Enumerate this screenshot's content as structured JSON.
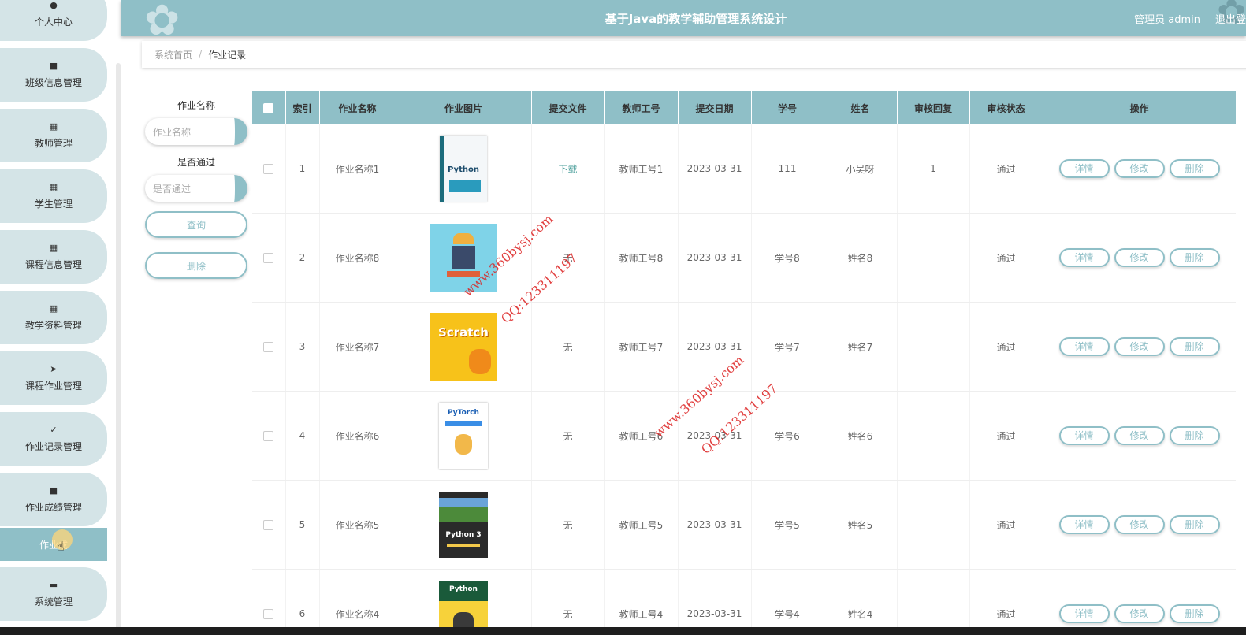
{
  "header": {
    "title": "基于Java的教学辅助管理系统设计",
    "user": "管理员 admin",
    "logout": "退出登"
  },
  "breadcrumb": {
    "home": "系统首页",
    "separator": "/",
    "current": "作业记录"
  },
  "sidebar": {
    "items": [
      {
        "label": "个人中心",
        "icon": "user-icon"
      },
      {
        "label": "班级信息管理",
        "icon": "board-icon"
      },
      {
        "label": "教师管理",
        "icon": "grid-icon"
      },
      {
        "label": "学生管理",
        "icon": "grid-icon"
      },
      {
        "label": "课程信息管理",
        "icon": "grid-icon"
      },
      {
        "label": "教学资料管理",
        "icon": "grid-icon"
      },
      {
        "label": "课程作业管理",
        "icon": "send-icon"
      },
      {
        "label": "作业记录管理",
        "icon": "clipboard-icon"
      },
      {
        "label": "作业成绩管理",
        "icon": "chat-icon"
      },
      {
        "label": "系统管理",
        "icon": "wallet-icon"
      }
    ],
    "active_sub": "作业成"
  },
  "search": {
    "name_label": "作业名称",
    "name_placeholder": "作业名称",
    "pass_label": "是否通过",
    "pass_placeholder": "是否通过",
    "query_button": "查询",
    "delete_button": "删除"
  },
  "table": {
    "headers": [
      "索引",
      "作业名称",
      "作业图片",
      "提交文件",
      "教师工号",
      "提交日期",
      "学号",
      "姓名",
      "审核回复",
      "审核状态",
      "操作"
    ],
    "rows": [
      {
        "index": "1",
        "name": "作业名称1",
        "image": "Python",
        "file": "下载",
        "teacher": "教师工号1",
        "date": "2023-03-31",
        "sid": "111",
        "sname": "小吴呀",
        "reply": "1",
        "status": "通过"
      },
      {
        "index": "2",
        "name": "作业名称8",
        "image": "",
        "file": "无",
        "teacher": "教师工号8",
        "date": "2023-03-31",
        "sid": "学号8",
        "sname": "姓名8",
        "reply": "",
        "status": "通过"
      },
      {
        "index": "3",
        "name": "作业名称7",
        "image": "Scratch",
        "file": "无",
        "teacher": "教师工号7",
        "date": "2023-03-31",
        "sid": "学号7",
        "sname": "姓名7",
        "reply": "",
        "status": "通过"
      },
      {
        "index": "4",
        "name": "作业名称6",
        "image": "PyTorch",
        "file": "无",
        "teacher": "教师工号6",
        "date": "2023-03-31",
        "sid": "学号6",
        "sname": "姓名6",
        "reply": "",
        "status": "通过"
      },
      {
        "index": "5",
        "name": "作业名称5",
        "image": "Python 3",
        "file": "无",
        "teacher": "教师工号5",
        "date": "2023-03-31",
        "sid": "学号5",
        "sname": "姓名5",
        "reply": "",
        "status": "通过"
      },
      {
        "index": "6",
        "name": "作业名称4",
        "image": "Python",
        "file": "无",
        "teacher": "教师工号4",
        "date": "2023-03-31",
        "sid": "学号4",
        "sname": "姓名4",
        "reply": "",
        "status": "通过"
      }
    ],
    "actions": {
      "detail": "详情",
      "edit": "修改",
      "delete": "删除"
    }
  },
  "watermarks": {
    "site": "www.360bysj.com",
    "qq": "QQ:123311197"
  },
  "colors": {
    "accent": "#8fbfc7",
    "nav_bg": "#d4e4e7",
    "watermark": "#dc1e1e"
  }
}
